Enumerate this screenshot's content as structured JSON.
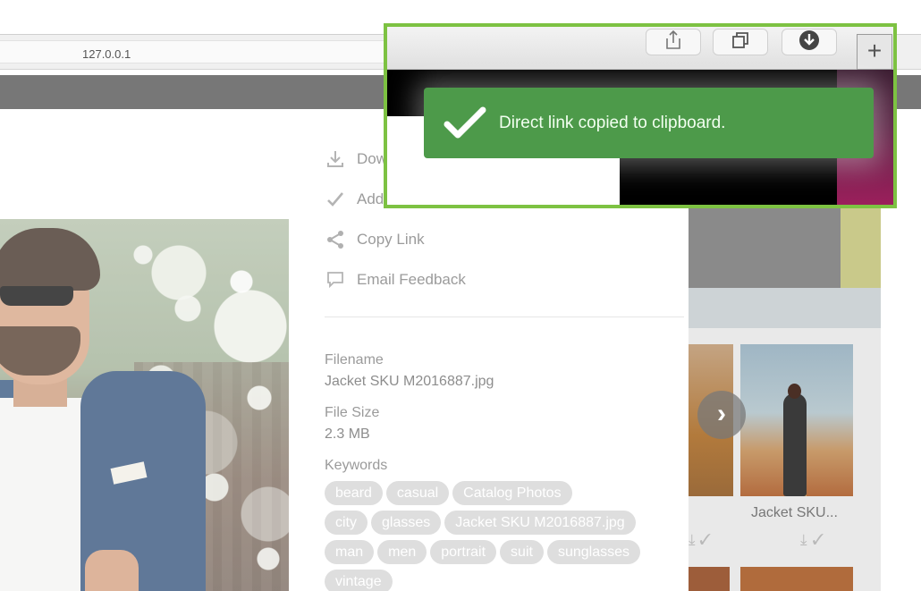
{
  "browser": {
    "url": "127.0.0.1"
  },
  "sidebar": {
    "actions": [
      {
        "label": "Dow",
        "icon": "download-icon"
      },
      {
        "label": "Add",
        "icon": "checkmark-icon"
      },
      {
        "label": "Copy Link",
        "icon": "share-icon"
      },
      {
        "label": "Email Feedback",
        "icon": "speech-bubble-icon"
      }
    ],
    "meta": {
      "filename_label": "Filename",
      "filename_value": "Jacket SKU M2016887.jpg",
      "filesize_label": "File Size",
      "filesize_value": "2.3 MB",
      "keywords_label": "Keywords"
    },
    "keywords": [
      [
        "beard",
        "casual",
        "Catalog Photos"
      ],
      [
        "city",
        "glasses",
        "Jacket SKU M2016887.jpg"
      ],
      [
        "man",
        "men",
        "portrait",
        "suit",
        "sunglasses"
      ],
      [
        "vintage"
      ]
    ]
  },
  "gallery": {
    "thumb_caption": "Jacket SKU...",
    "next_label": "›"
  },
  "toast": {
    "message": "Direct link copied to clipboard."
  },
  "safari_toolbar": {
    "buttons": [
      "share-icon",
      "tabs-icon",
      "download-icon"
    ],
    "new_tab_label": "+"
  },
  "colors": {
    "highlight_border": "#7dc242",
    "toast_bg": "#4d9a4a"
  }
}
